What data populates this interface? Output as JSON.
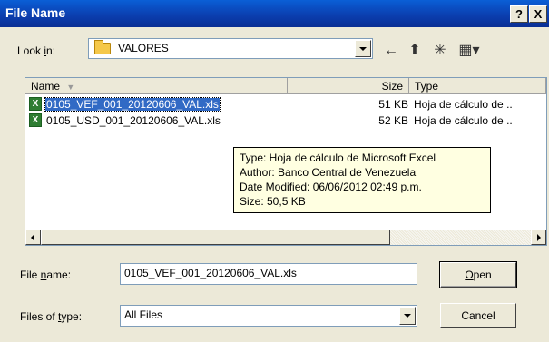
{
  "window": {
    "title": "File Name",
    "help_button": "?",
    "close_button": "X"
  },
  "lookin": {
    "label_prefix": "Look ",
    "label_hotkey": "i",
    "label_suffix": "n:",
    "value": "VALORES",
    "folder_icon": "folder-icon"
  },
  "toolbar": {
    "back_icon": "←",
    "up_icon": "⬆",
    "newfolder_icon": "✳",
    "views_icon": "▦▾"
  },
  "list": {
    "columns": {
      "name": "Name",
      "sort_indicator": "▼",
      "size": "Size",
      "type": "Type"
    },
    "rows": [
      {
        "name": "0105_VEF_001_20120606_VAL.xls",
        "size": "51 KB",
        "type": "Hoja de cálculo de ..",
        "selected": true
      },
      {
        "name": "0105_USD_001_20120606_VAL.xls",
        "size": "52 KB",
        "type": "Hoja de cálculo de ..",
        "selected": false
      }
    ],
    "tooltip": {
      "type": "Type: Hoja de cálculo de Microsoft Excel",
      "author": "Author: Banco Central de Venezuela",
      "modified": "Date Modified: 06/06/2012 02:49 p.m.",
      "size": "Size: 50,5 KB"
    }
  },
  "form": {
    "filename_label_prefix": "File ",
    "filename_label_hotkey": "n",
    "filename_label_suffix": "ame:",
    "filename_value": "0105_VEF_001_20120606_VAL.xls",
    "filetype_label_prefix": "Files of ",
    "filetype_label_hotkey": "t",
    "filetype_label_suffix": "ype:",
    "filetype_value": "All Files",
    "open_hotkey": "O",
    "open_rest": "pen",
    "cancel_label": "Cancel"
  }
}
